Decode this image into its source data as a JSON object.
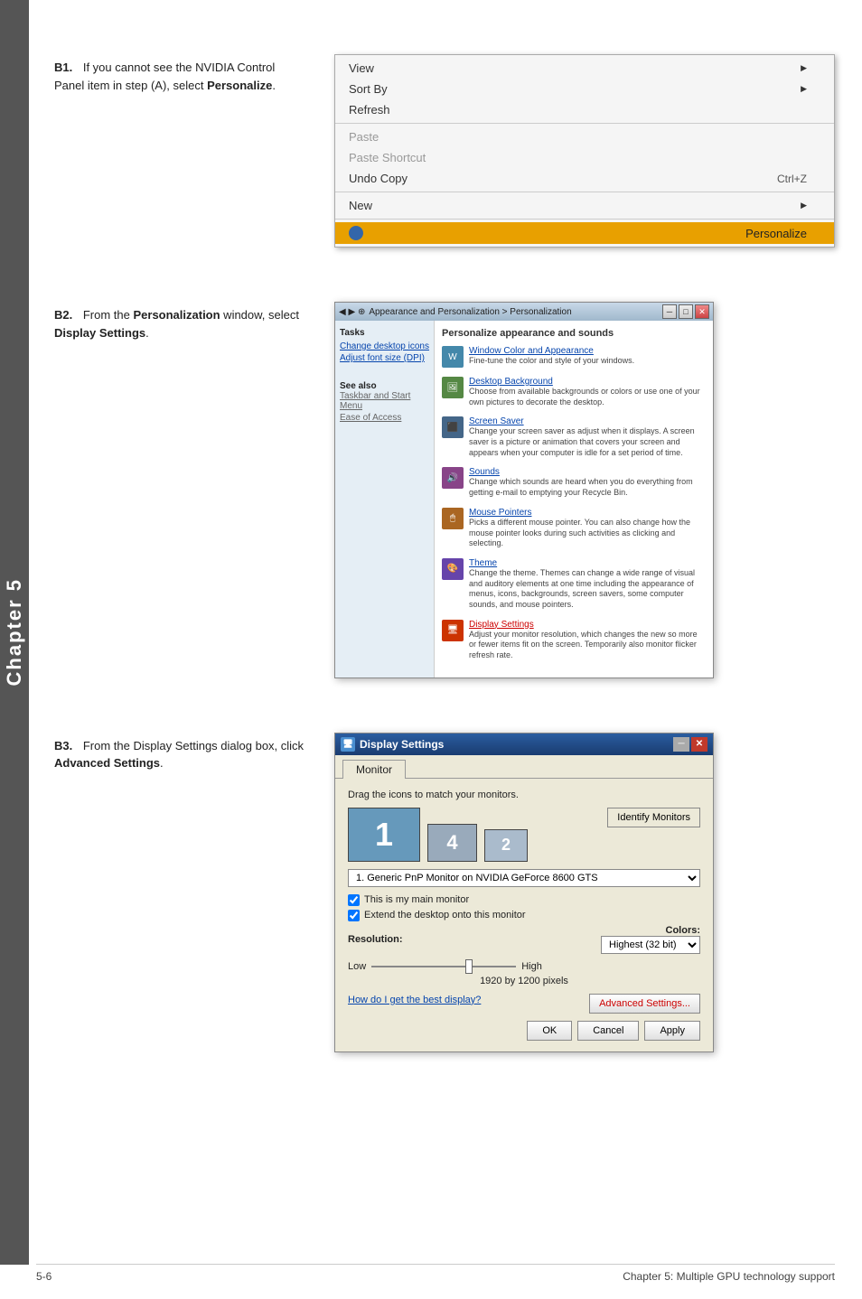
{
  "chapter": {
    "label": "Chapter 5"
  },
  "sections": [
    {
      "id": "B1",
      "step": "B1.",
      "text_before": "If you cannot see the NVIDIA Control Panel item in step (A), select ",
      "text_bold": "Personalize",
      "text_after": ".",
      "image_type": "context_menu"
    },
    {
      "id": "B2",
      "step": "B2.",
      "text_before": "From the ",
      "text_bold": "Personalization",
      "text_middle": " window, select ",
      "text_bold2": "Display Settings",
      "text_after": ".",
      "image_type": "persona_window"
    },
    {
      "id": "B3",
      "step": "B3.",
      "text_before": "From the Display Settings dialog box, click ",
      "text_bold": "Advanced Settings",
      "text_after": ".",
      "image_type": "display_settings"
    }
  ],
  "context_menu": {
    "items": [
      {
        "label": "View",
        "has_arrow": true,
        "grayed": false
      },
      {
        "label": "Sort By",
        "has_arrow": true,
        "grayed": false
      },
      {
        "label": "Refresh",
        "has_arrow": false,
        "grayed": false
      },
      {
        "separator": true
      },
      {
        "label": "Paste",
        "has_arrow": false,
        "grayed": true
      },
      {
        "label": "Paste Shortcut",
        "has_arrow": false,
        "grayed": true
      },
      {
        "label": "Undo Copy",
        "shortcut": "Ctrl+Z",
        "has_arrow": false,
        "grayed": false
      },
      {
        "separator": true
      },
      {
        "label": "New",
        "has_arrow": true,
        "grayed": false
      },
      {
        "separator": true
      },
      {
        "label": "Personalize",
        "has_arrow": false,
        "highlighted": true,
        "grayed": false
      }
    ]
  },
  "persona_window": {
    "title": "Appearance and Personalization > Personalization",
    "main_title": "Personalize appearance and sounds",
    "sidebar_title": "Tasks",
    "sidebar_links": [
      {
        "label": "Change desktop icons"
      },
      {
        "label": "Adjust font size (DPI)"
      }
    ],
    "sidebar_bottom_links": [
      {
        "label": "See also"
      },
      {
        "label": "Taskbar and Start Menu"
      },
      {
        "label": "Ease of Access"
      }
    ],
    "items": [
      {
        "title": "Window Color and Appearance",
        "desc": "Fine-tune the color and style of your windows.",
        "color": "#4488aa"
      },
      {
        "title": "Desktop Background",
        "desc": "Choose from available backgrounds or colors or use one of your own pictures to decorate the desktop.",
        "color": "#558844"
      },
      {
        "title": "Screen Saver",
        "desc": "Change your screen saver as adjust when it displays. A screen saver is a picture or animation that covers your screen and appears when your computer is idle for a set period of time.",
        "color": "#446688"
      },
      {
        "title": "Sounds",
        "desc": "Change which sounds are heard when you do everything from getting e-mail to emptying your Recycle Bin.",
        "color": "#884488"
      },
      {
        "title": "Mouse Pointers",
        "desc": "Picks a different mouse pointer. You can also change how the mouse pointer looks during such activities as clicking and selecting.",
        "color": "#aa6622"
      },
      {
        "title": "Theme",
        "desc": "Change the theme. Themes can change a wide range of visual and auditory elements at one time including the appearance of menus, icons, backgrounds, screen savers, some computer sounds, and mouse pointers.",
        "color": "#6644aa"
      },
      {
        "title": "Display Settings",
        "desc": "Adjust your monitor resolution, which changes the new so more or fewer items fit on the screen. Temporarily also monitor flicker refresh rate.",
        "color": "#cc3300",
        "active": true
      }
    ]
  },
  "display_settings": {
    "title": "Display Settings",
    "tab": "Monitor",
    "drag_text": "Drag the icons to match your monitors.",
    "identify_btn": "Identify Monitors",
    "monitor_numbers": [
      "1",
      "4",
      "2"
    ],
    "dropdown_value": "1. Generic PnP Monitor on NVIDIA GeForce 8600 GTS",
    "checkbox1": "This is my main monitor",
    "checkbox2": "Extend the desktop onto this monitor",
    "resolution_label": "Resolution:",
    "colors_label": "Colors:",
    "slider_low": "Low",
    "slider_high": "High",
    "resolution_value": "1920 by 1200 pixels",
    "colors_value": "Highest (32 bit)",
    "link_text": "How do I get the best display?",
    "advanced_btn": "Advanced Settings...",
    "ok_btn": "OK",
    "cancel_btn": "Cancel",
    "apply_btn": "Apply"
  },
  "footer": {
    "left": "5-6",
    "right": "Chapter 5: Multiple GPU technology support"
  }
}
